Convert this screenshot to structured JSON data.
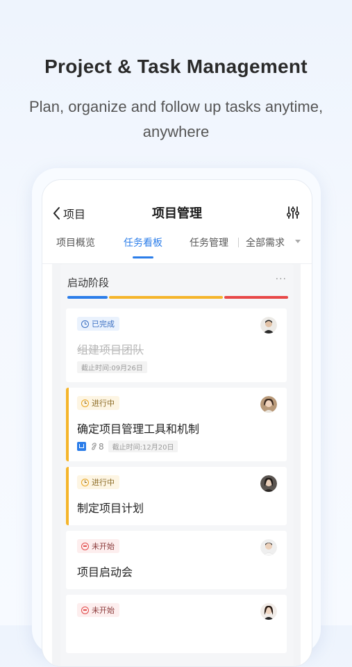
{
  "headline": "Project & Task Management",
  "subline": "Plan, organize and follow up tasks anytime, anywhere",
  "nav": {
    "back_label": "项目",
    "title": "项目管理"
  },
  "tabs": [
    {
      "label": "项目概览"
    },
    {
      "label": "任务看板",
      "active": true
    },
    {
      "label": "任务管理"
    },
    {
      "label": "全部需求"
    }
  ],
  "column": {
    "title": "启动阶段",
    "more": "···",
    "progress_colors": [
      "#2b7de9",
      "#f5b52b",
      "#e84848"
    ]
  },
  "cards": [
    {
      "status": "已完成",
      "status_type": "done",
      "title": "组建项目团队",
      "deadline": "截止时间:09月26日",
      "avatar": "man-avatar-1"
    },
    {
      "status": "进行中",
      "status_type": "doing",
      "title": "确定项目管理工具和机制",
      "attachments": "8",
      "deadline": "截止时间:12月20日",
      "avatar": "woman-avatar-1"
    },
    {
      "status": "进行中",
      "status_type": "doing",
      "title": "制定项目计划",
      "avatar": "woman-avatar-2"
    },
    {
      "status": "未开始",
      "status_type": "todo",
      "title": "项目启动会",
      "avatar": "man-avatar-2"
    },
    {
      "status": "未开始",
      "status_type": "todo",
      "title": "",
      "avatar": "woman-avatar-3"
    }
  ]
}
